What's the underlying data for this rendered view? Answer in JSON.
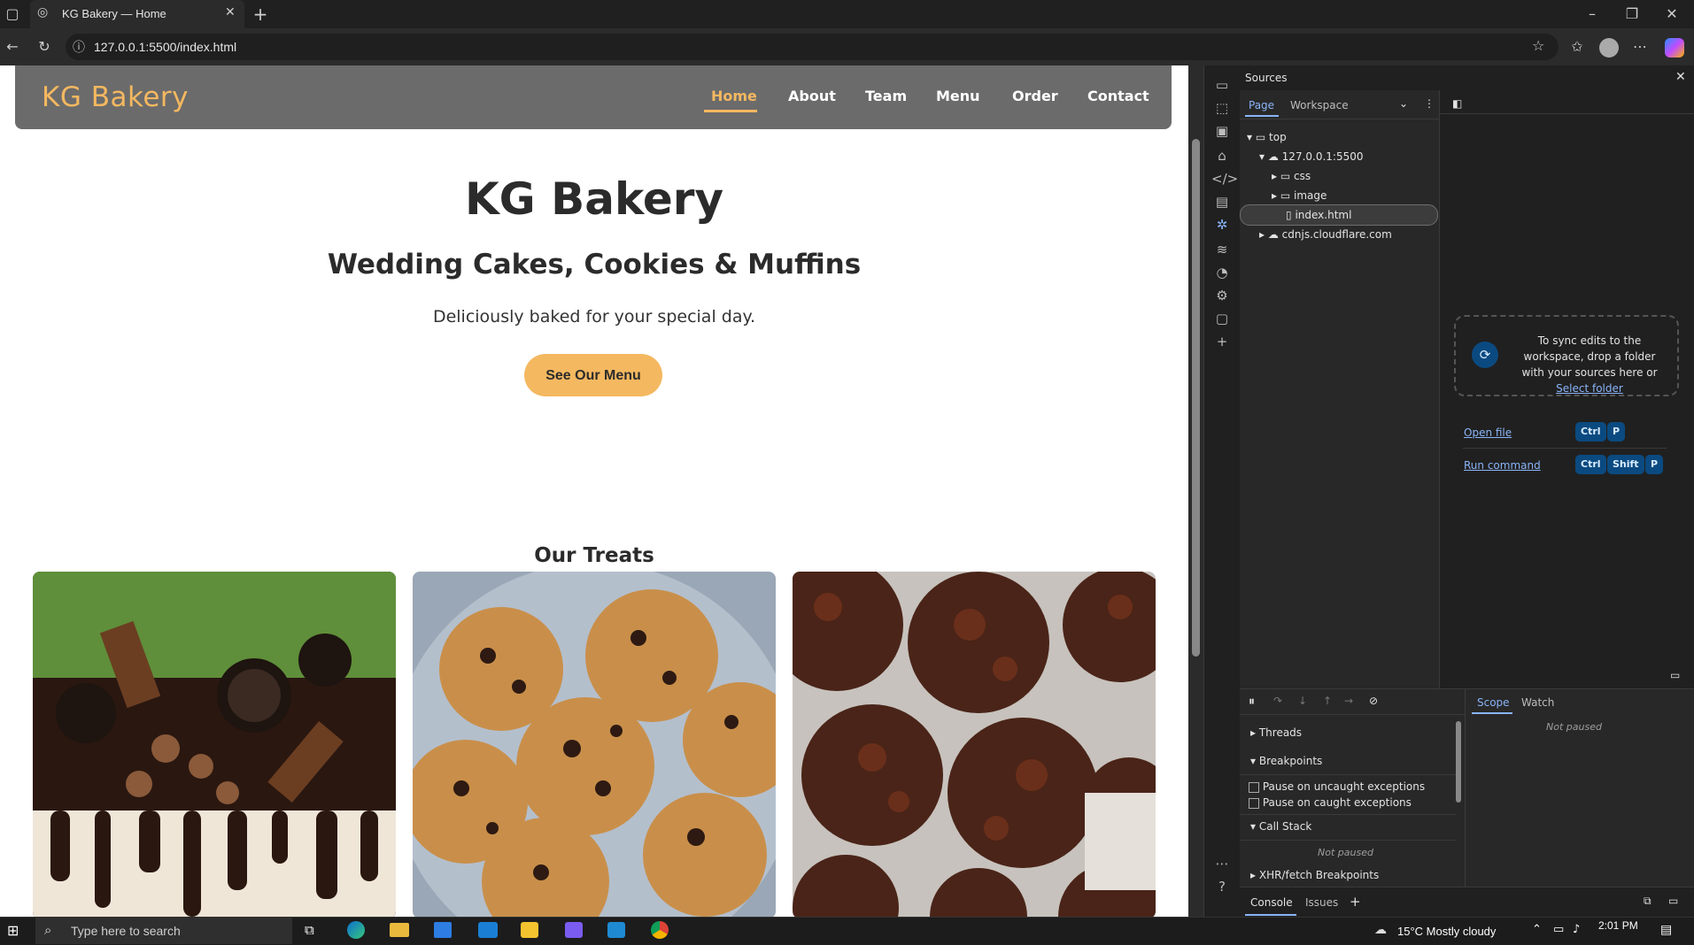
{
  "browser": {
    "tab_title": "KG Bakery — Home",
    "url": "127.0.0.1:5500/index.html"
  },
  "site": {
    "brand": "KG Bakery",
    "nav": [
      "Home",
      "About",
      "Team",
      "Menu",
      "Order",
      "Contact"
    ],
    "active_nav": "Home",
    "hero_title": "KG Bakery",
    "hero_subtitle": "Wedding Cakes, Cookies & Muffins",
    "hero_tagline": "Deliciously baked for your special day.",
    "cta_label": "See Our Menu",
    "treats_title": "Our Treats",
    "treat_images": [
      "chocolate-drip-cake",
      "chocolate-chip-cookies",
      "chocolate-muffins"
    ]
  },
  "devtools": {
    "panel_title": "Sources",
    "tabs": [
      "Page",
      "Workspace"
    ],
    "active_tab": "Page",
    "tree": {
      "top": "top",
      "origin": "127.0.0.1:5500",
      "folders": [
        "css",
        "image"
      ],
      "file": "index.html",
      "cdn": "cdnjs.cloudflare.com"
    },
    "sync_text_1": "To sync edits to the workspace, drop a folder with your sources here or",
    "sync_link": "Select folder",
    "open_file": "Open file",
    "run_command": "Run command",
    "keys": {
      "ctrl": "Ctrl",
      "shift": "Shift",
      "p": "P"
    },
    "debug_sections": {
      "threads": "Threads",
      "breakpoints": "Breakpoints",
      "pause_uncaught": "Pause on uncaught exceptions",
      "pause_caught": "Pause on caught exceptions",
      "call_stack": "Call Stack",
      "not_paused": "Not paused",
      "xhr": "XHR/fetch Breakpoints"
    },
    "scope_tabs": [
      "Scope",
      "Watch"
    ],
    "scope_not_paused": "Not paused",
    "drawer_tabs": [
      "Console",
      "Issues"
    ]
  },
  "taskbar": {
    "search_placeholder": "Type here to search",
    "weather": "15°C  Mostly cloudy",
    "time": "2:01 PM"
  },
  "colors": {
    "accent": "#f4b860",
    "nav_bg": "#6b6b6b",
    "devtools_bg": "#282828",
    "link": "#8ab4f8"
  }
}
